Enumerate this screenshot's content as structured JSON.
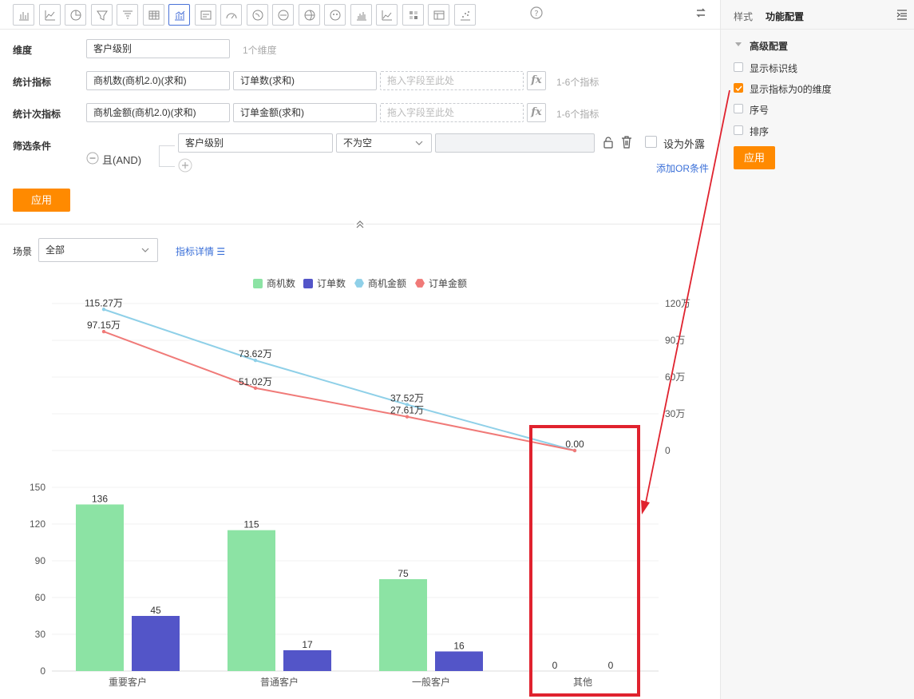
{
  "toolbar": {
    "buttons": [
      "bar-chart-icon",
      "line-chart-icon",
      "pie-chart-icon",
      "funnel-icon",
      "funnel-alt-icon",
      "table-icon",
      "combo-chart-icon",
      "card-icon",
      "gauge-icon",
      "map-cn-icon",
      "map-cn-alt-icon",
      "globe-icon",
      "radar-icon",
      "column-icon",
      "area-chart-icon",
      "heatmap-icon",
      "pivot-icon",
      "scatter-icon"
    ],
    "active_index": 6
  },
  "config": {
    "dimension_label": "维度",
    "dimension_value": "客户级别",
    "dimension_hint": "1个维度",
    "metric_label": "统计指标",
    "metric_1": "商机数(商机2.0)(求和)",
    "metric_2": "订单数(求和)",
    "metric_placeholder": "拖入字段至此处",
    "metric_hint": "1-6个指标",
    "sub_metric_label": "统计次指标",
    "sub_metric_1": "商机金额(商机2.0)(求和)",
    "sub_metric_2": "订单金额(求和)",
    "sub_metric_placeholder": "拖入字段至此处",
    "sub_metric_hint": "1-6个指标",
    "filter_label": "筛选条件",
    "filter_logic": "且(AND)",
    "filter_field": "客户级别",
    "filter_op": "不为空",
    "expose_label": "设为外露",
    "add_or": "添加OR条件",
    "apply": "应用",
    "fx": "fx"
  },
  "scene": {
    "label": "场景",
    "value": "全部",
    "metric_detail": "指标详情"
  },
  "right_panel": {
    "tab_style": "样式",
    "tab_function": "功能配置",
    "section": "高级配置",
    "options": [
      {
        "label": "显示标识线",
        "checked": false
      },
      {
        "label": "显示指标为0的维度",
        "checked": true
      },
      {
        "label": "序号",
        "checked": false
      },
      {
        "label": "排序",
        "checked": false
      }
    ],
    "apply": "应用"
  },
  "colors": {
    "accent": "#ff8a00",
    "bar1": "#8ce3a4",
    "bar2": "#5355c8",
    "line1": "#8fd0e8",
    "line2": "#f07a78",
    "highlight": "#e0222e",
    "link": "#3a6fd8"
  },
  "chart_data": {
    "type": "bar",
    "categories": [
      "重要客户",
      "普通客户",
      "一般客户",
      "其他"
    ],
    "legend": [
      "商机数",
      "订单数",
      "商机金额",
      "订单金额"
    ],
    "bar_series": [
      {
        "name": "商机数",
        "values": [
          136,
          115,
          75,
          0
        ]
      },
      {
        "name": "订单数",
        "values": [
          45,
          17,
          16,
          0
        ]
      }
    ],
    "bar_axis_ticks": [
      "0",
      "30",
      "60",
      "90",
      "120",
      "150"
    ],
    "bar_ylim": [
      0,
      150
    ],
    "line_series": [
      {
        "name": "商机金额",
        "values": [
          115.27,
          73.62,
          37.52,
          0
        ],
        "labels": [
          "115.27万",
          "73.62万",
          "37.52万",
          "0.00"
        ]
      },
      {
        "name": "订单金额",
        "values": [
          97.15,
          51.02,
          27.61,
          0
        ],
        "labels": [
          "97.15万",
          "51.02万",
          "27.61万",
          ""
        ]
      }
    ],
    "line_axis_ticks": [
      "0",
      "30万",
      "60万",
      "90万",
      "120万"
    ],
    "line_ylim": [
      0,
      120
    ]
  }
}
